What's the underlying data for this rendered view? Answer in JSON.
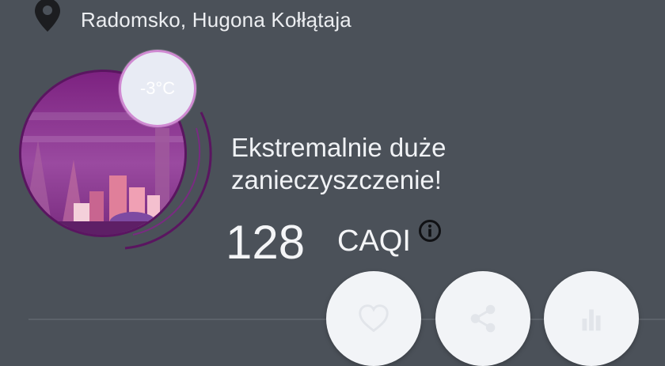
{
  "header": {
    "location": "Radomsko, Hugona Kołłątaja",
    "location_icon": "map-pin-icon"
  },
  "weather": {
    "temperature": "-3°C"
  },
  "air_quality": {
    "status": "Ekstremalnie duże zanieczyszczenie!",
    "value": "128",
    "unit": "CAQI",
    "info_icon": "info-icon",
    "accent_color": "#7a1f7e"
  },
  "actions": [
    {
      "name": "favorite",
      "icon": "heart-icon"
    },
    {
      "name": "share",
      "icon": "share-icon"
    },
    {
      "name": "stats",
      "icon": "bar-chart-icon"
    }
  ]
}
